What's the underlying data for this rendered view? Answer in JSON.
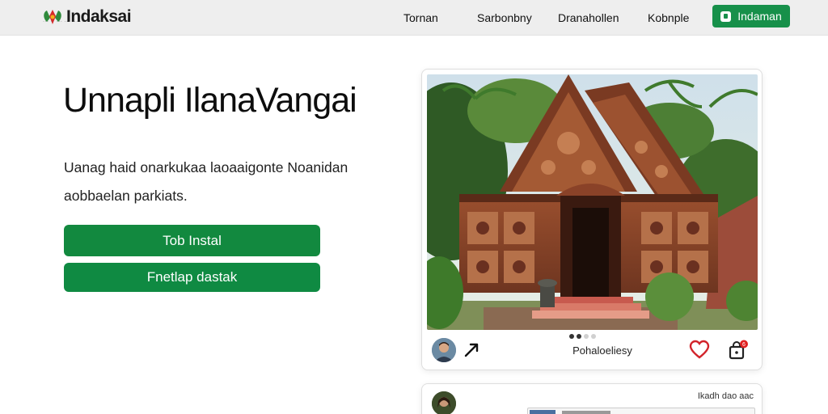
{
  "header": {
    "logo_text": "Indaksai",
    "nav": [
      "Tornan",
      "Sarbonbny",
      "Dranahollen",
      "Kobnple"
    ],
    "cta_label": "Indaman"
  },
  "hero": {
    "title": "Unnapli IlanaVangai",
    "description": "Uanag haid  onarkukaa laoaaigonte Noanidan aobbaelan parkiats.",
    "primary_button": "Tob Instal",
    "secondary_button": "Fnetlap dastak"
  },
  "card": {
    "caption": "Pohaloeliesy",
    "carousel": {
      "total": 4,
      "active": 1
    },
    "icons": [
      "avatar",
      "share-icon",
      "heart-icon",
      "bag-icon"
    ],
    "notification_count": "6"
  },
  "card2": {
    "meta": "Ikadh dao aac"
  },
  "colors": {
    "accent": "#12893f",
    "header_bg": "#eeeeee",
    "heart": "#d2232a",
    "badge": "#e02020"
  }
}
